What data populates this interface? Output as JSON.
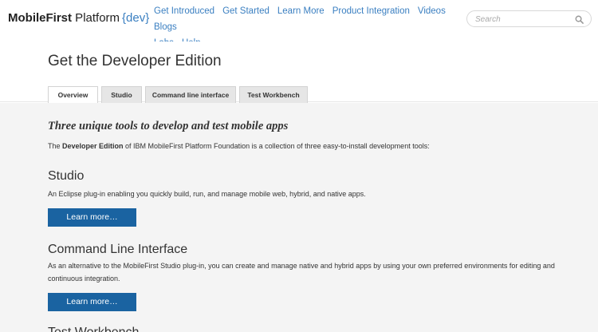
{
  "header": {
    "logo": {
      "bold": "MobileFirst",
      "rest": " Platform",
      "dev": "{dev}"
    },
    "nav": [
      "Get Introduced",
      "Get Started",
      "Learn More",
      "Product Integration",
      "Videos",
      "Blogs",
      "Labs",
      "Help"
    ],
    "search": {
      "placeholder": "Search",
      "icon": "search-icon"
    }
  },
  "page": {
    "title": "Get the Developer Edition",
    "tabs": [
      {
        "label": "Overview",
        "active": true
      },
      {
        "label": "Studio",
        "active": false
      },
      {
        "label": "Command line interface",
        "active": false
      },
      {
        "label": "Test Workbench",
        "active": false
      }
    ]
  },
  "intro": {
    "heading": "Three unique tools to develop and test mobile apps",
    "text_prefix": "The ",
    "text_bold": "Developer Edition",
    "text_suffix": " of IBM MobileFirst Platform Foundation is a collection of three easy-to-install development tools:"
  },
  "sections": [
    {
      "title": "Studio",
      "description": "An Eclipse plug-in enabling you quickly build, run, and manage mobile web, hybrid, and native apps.",
      "button": "Learn more…"
    },
    {
      "title": "Command Line Interface",
      "description": "As an alternative to the MobileFirst Studio plug-in, you can create and manage native and hybrid apps by using your own preferred environments for editing and continuous integration.",
      "button": "Learn more…"
    },
    {
      "title": "Test Workbench"
    }
  ],
  "colors": {
    "link": "#3a7fc1",
    "button": "#1a63a1",
    "content_bg": "#f4f4f4"
  }
}
